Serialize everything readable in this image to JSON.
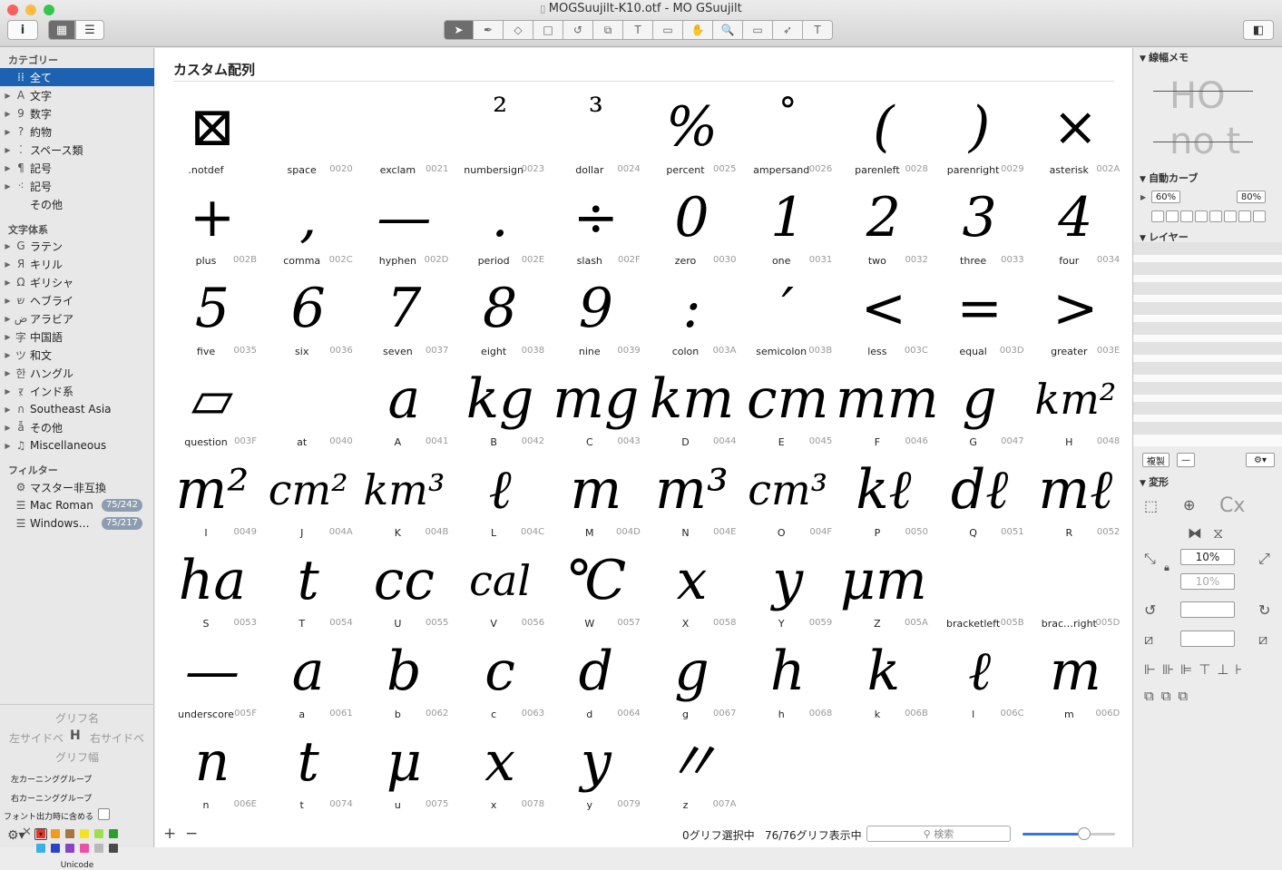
{
  "window": {
    "title": "MOGSuujilt-K10.otf - MO GSuujilt",
    "colors": {
      "close": "#fc605b",
      "minimize": "#fdbc40",
      "zoom": "#34c84a",
      "accent": "#1d62b0"
    }
  },
  "toolbar": {
    "info_icon": "i",
    "grid_icon": "▦",
    "list_icon": "☰",
    "tools": [
      "➤",
      "✒",
      "◇",
      "□",
      "↺",
      "⧉",
      "T",
      "▭",
      "✋",
      "🔍",
      "▭",
      "➶",
      "T"
    ]
  },
  "sidebar": {
    "categories_header": "カテゴリー",
    "categories": [
      {
        "icon": "⁞⁞",
        "label": "全て",
        "selected": true
      },
      {
        "icon": "A",
        "label": "文字"
      },
      {
        "icon": "9",
        "label": "数字"
      },
      {
        "icon": "?",
        "label": "約物"
      },
      {
        "icon": "⁚",
        "label": "スペース類"
      },
      {
        "icon": "¶",
        "label": "記号"
      },
      {
        "icon": "⁖",
        "label": "記号"
      },
      {
        "icon": "",
        "label": "その他"
      }
    ],
    "scripts_header": "文字体系",
    "scripts": [
      {
        "icon": "G",
        "label": "ラテン"
      },
      {
        "icon": "Я",
        "label": "キリル"
      },
      {
        "icon": "Ω",
        "label": "ギリシャ"
      },
      {
        "icon": "ש",
        "label": "ヘブライ"
      },
      {
        "icon": "ض",
        "label": "アラビア"
      },
      {
        "icon": "字",
        "label": "中国語"
      },
      {
        "icon": "ツ",
        "label": "和文"
      },
      {
        "icon": "한",
        "label": "ハングル"
      },
      {
        "icon": "ऱ",
        "label": "インド系"
      },
      {
        "icon": "ก",
        "label": "Southeast Asia"
      },
      {
        "icon": "ẫ",
        "label": "その他"
      },
      {
        "icon": "♫",
        "label": "Miscellaneous"
      }
    ],
    "filters_header": "フィルター",
    "filters": [
      {
        "icon": "⚙",
        "label": "マスター非互換",
        "badge": ""
      },
      {
        "icon": "☰",
        "label": "Mac Roman",
        "badge": "75/242"
      },
      {
        "icon": "☰",
        "label": "Windows…",
        "badge": "75/217"
      }
    ],
    "bottom": {
      "glyph_name": "グリフ名",
      "left_side": "左サイドベ",
      "right_side": "右サイドベ",
      "glyph_width": "グリフ幅",
      "left_kern": "左カーニンググループ",
      "right_kern": "右カーニンググループ",
      "export": "フォント出力時に含める",
      "unicode": "Unicode",
      "swatches": [
        "#e8332a",
        "#f39a1e",
        "#a87741",
        "#f4e322",
        "#9ee04b",
        "#2b9f2e",
        "#3ab0e8",
        "#2a44c6",
        "#8b43c6",
        "#ee4fa6",
        "#b9b9b9",
        "#4a4a4a"
      ]
    }
  },
  "main": {
    "heading": "カスタム配列",
    "glyphs": [
      {
        "glyph": "⊠",
        "name": ".notdef",
        "code": ""
      },
      {
        "glyph": "",
        "name": "space",
        "code": "0020"
      },
      {
        "glyph": "",
        "name": "exclam",
        "code": "0021"
      },
      {
        "glyph": "²",
        "name": "numbersign",
        "code": "0023"
      },
      {
        "glyph": "³",
        "name": "dollar",
        "code": "0024"
      },
      {
        "glyph": "%",
        "name": "percent",
        "code": "0025"
      },
      {
        "glyph": "°",
        "name": "ampersand",
        "code": "0026"
      },
      {
        "glyph": "(",
        "name": "parenleft",
        "code": "0028"
      },
      {
        "glyph": ")",
        "name": "parenright",
        "code": "0029"
      },
      {
        "glyph": "×",
        "name": "asterisk",
        "code": "002A"
      },
      {
        "glyph": "+",
        "name": "plus",
        "code": "002B"
      },
      {
        "glyph": ",",
        "name": "comma",
        "code": "002C"
      },
      {
        "glyph": "—",
        "name": "hyphen",
        "code": "002D"
      },
      {
        "glyph": ".",
        "name": "period",
        "code": "002E"
      },
      {
        "glyph": "÷",
        "name": "slash",
        "code": "002F"
      },
      {
        "glyph": "0",
        "name": "zero",
        "code": "0030"
      },
      {
        "glyph": "1",
        "name": "one",
        "code": "0031"
      },
      {
        "glyph": "2",
        "name": "two",
        "code": "0032"
      },
      {
        "glyph": "3",
        "name": "three",
        "code": "0033"
      },
      {
        "glyph": "4",
        "name": "four",
        "code": "0034"
      },
      {
        "glyph": "5",
        "name": "five",
        "code": "0035"
      },
      {
        "glyph": "6",
        "name": "six",
        "code": "0036"
      },
      {
        "glyph": "7",
        "name": "seven",
        "code": "0037"
      },
      {
        "glyph": "8",
        "name": "eight",
        "code": "0038"
      },
      {
        "glyph": "9",
        "name": "nine",
        "code": "0039"
      },
      {
        "glyph": ":",
        "name": "colon",
        "code": "003A"
      },
      {
        "glyph": "′",
        "name": "semicolon",
        "code": "003B"
      },
      {
        "glyph": "<",
        "name": "less",
        "code": "003C"
      },
      {
        "glyph": "=",
        "name": "equal",
        "code": "003D"
      },
      {
        "glyph": ">",
        "name": "greater",
        "code": "003E"
      },
      {
        "glyph": "▱",
        "name": "question",
        "code": "003F"
      },
      {
        "glyph": "",
        "name": "at",
        "code": "0040"
      },
      {
        "glyph": "a",
        "name": "A",
        "code": "0041"
      },
      {
        "glyph": "kg",
        "name": "B",
        "code": "0042"
      },
      {
        "glyph": "mg",
        "name": "C",
        "code": "0043"
      },
      {
        "glyph": "km",
        "name": "D",
        "code": "0044"
      },
      {
        "glyph": "cm",
        "name": "E",
        "code": "0045"
      },
      {
        "glyph": "mm",
        "name": "F",
        "code": "0046"
      },
      {
        "glyph": "g",
        "name": "G",
        "code": "0047"
      },
      {
        "glyph": "km²",
        "name": "H",
        "code": "0048"
      },
      {
        "glyph": "m²",
        "name": "I",
        "code": "0049"
      },
      {
        "glyph": "cm²",
        "name": "J",
        "code": "004A"
      },
      {
        "glyph": "km³",
        "name": "K",
        "code": "004B"
      },
      {
        "glyph": "ℓ",
        "name": "L",
        "code": "004C"
      },
      {
        "glyph": "m",
        "name": "M",
        "code": "004D"
      },
      {
        "glyph": "m³",
        "name": "N",
        "code": "004E"
      },
      {
        "glyph": "cm³",
        "name": "O",
        "code": "004F"
      },
      {
        "glyph": "kℓ",
        "name": "P",
        "code": "0050"
      },
      {
        "glyph": "dℓ",
        "name": "Q",
        "code": "0051"
      },
      {
        "glyph": "mℓ",
        "name": "R",
        "code": "0052"
      },
      {
        "glyph": "ha",
        "name": "S",
        "code": "0053"
      },
      {
        "glyph": "t",
        "name": "T",
        "code": "0054"
      },
      {
        "glyph": "cc",
        "name": "U",
        "code": "0055"
      },
      {
        "glyph": "cal",
        "name": "V",
        "code": "0056"
      },
      {
        "glyph": "℃",
        "name": "W",
        "code": "0057"
      },
      {
        "glyph": "x",
        "name": "X",
        "code": "0058"
      },
      {
        "glyph": "y",
        "name": "Y",
        "code": "0059"
      },
      {
        "glyph": "μm",
        "name": "Z",
        "code": "005A"
      },
      {
        "glyph": "",
        "name": "bracketleft",
        "code": "005B"
      },
      {
        "glyph": "",
        "name": "brac…right",
        "code": "005D"
      },
      {
        "glyph": "—",
        "name": "underscore",
        "code": "005F"
      },
      {
        "glyph": "a",
        "name": "a",
        "code": "0061"
      },
      {
        "glyph": "b",
        "name": "b",
        "code": "0062"
      },
      {
        "glyph": "c",
        "name": "c",
        "code": "0063"
      },
      {
        "glyph": "d",
        "name": "d",
        "code": "0064"
      },
      {
        "glyph": "g",
        "name": "g",
        "code": "0067"
      },
      {
        "glyph": "h",
        "name": "h",
        "code": "0068"
      },
      {
        "glyph": "k",
        "name": "k",
        "code": "006B"
      },
      {
        "glyph": "ℓ",
        "name": "l",
        "code": "006C"
      },
      {
        "glyph": "m",
        "name": "m",
        "code": "006D"
      },
      {
        "glyph": "n",
        "name": "n",
        "code": "006E"
      },
      {
        "glyph": "t",
        "name": "t",
        "code": "0074"
      },
      {
        "glyph": "μ",
        "name": "u",
        "code": "0075"
      },
      {
        "glyph": "x",
        "name": "x",
        "code": "0078"
      },
      {
        "glyph": "y",
        "name": "y",
        "code": "0079"
      },
      {
        "glyph": "〃",
        "name": "z",
        "code": "007A"
      }
    ]
  },
  "statusbar": {
    "add": "+",
    "remove": "−",
    "selected": "0グリフ選択中",
    "shown": "76/76グリフ表示中",
    "search_placeholder": "検索"
  },
  "inspector": {
    "width_memo": "線幅メモ",
    "memo_text1": "HO",
    "memo_text2": "no t",
    "auto_curve": "自動カーブ",
    "curve_a": "60%",
    "curve_b": "80%",
    "layers": "レイヤー",
    "duplicate": "複製",
    "minus": "—",
    "transform": "変形",
    "scale1": "10%",
    "scale2": "10%",
    "cx": "Cx"
  }
}
